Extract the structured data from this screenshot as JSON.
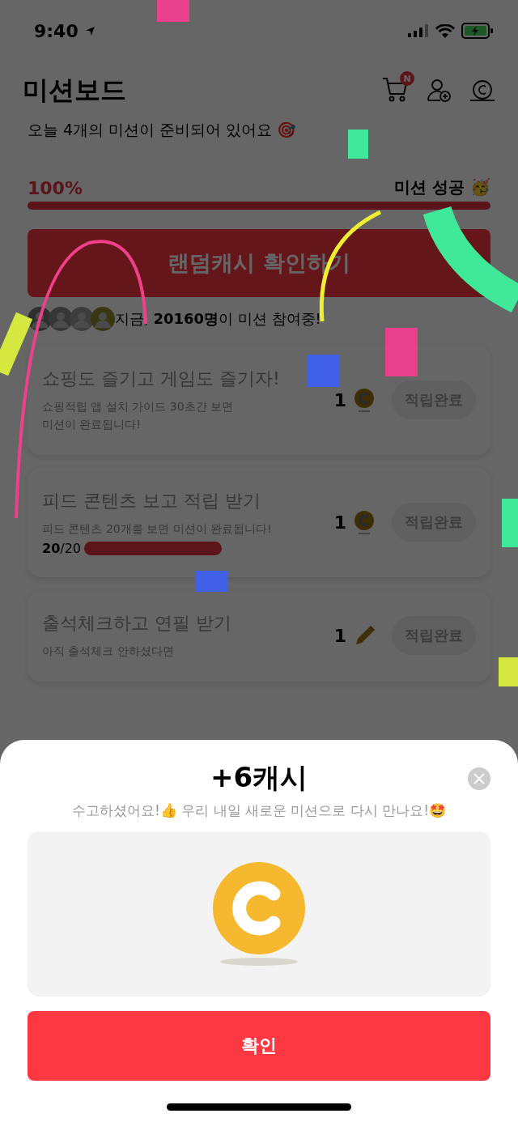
{
  "status_bar": {
    "time": "9:40"
  },
  "header": {
    "title": "미션보드",
    "cart_badge": "N"
  },
  "intro": {
    "text": "오늘 4개의 미션이 준비되어 있어요 🎯"
  },
  "progress": {
    "percent": "100%",
    "level": 1,
    "goal": "미션 성공 🥳"
  },
  "random_cash_button": "랜덤캐시 확인하기",
  "participants": {
    "prefix": "지금, ",
    "count": "20160명",
    "suffix": "이 미션 참여중!"
  },
  "missions": [
    {
      "title": "쇼핑도 즐기고 게임도 즐기자!",
      "description": "쇼핑적립 앱 설치 가이드 30초간 보면\n미션이 완료됩니다!",
      "reward": "1",
      "kind": "coin",
      "button": "적립완료"
    },
    {
      "title": "피드 콘텐츠 보고 적립 받기",
      "description": "피드 콘텐츠 20개를 보면 미션이 완료됩니다!",
      "count_done": "20",
      "count_total": "/20",
      "level": 1,
      "reward": "1",
      "kind": "coin",
      "button": "적립완료"
    },
    {
      "title": "출석체크하고 연필 받기",
      "description": "아직 출석체크 안하셨다면",
      "reward": "1",
      "kind": "pencil",
      "button": "적립완료"
    }
  ],
  "sheet": {
    "title": "+6캐시",
    "message": "수고하셨어요!👍 우리 내일 새로운 미션으로 다시 만나요!🤩",
    "confirm": "확인"
  }
}
